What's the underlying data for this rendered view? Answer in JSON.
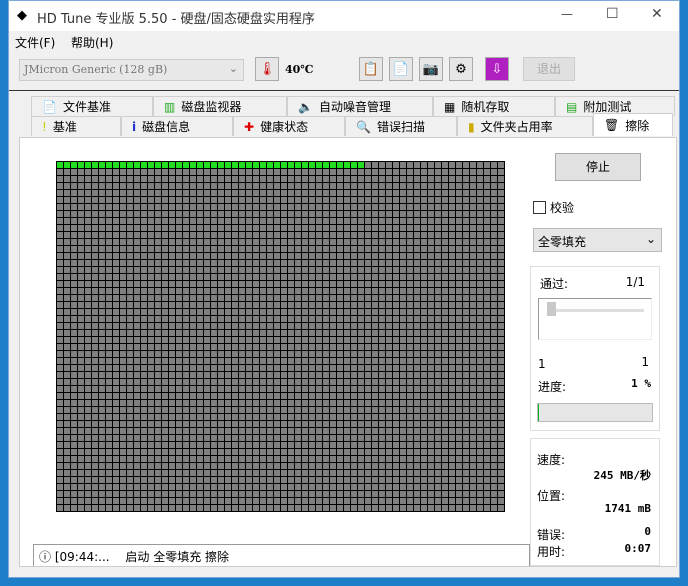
{
  "window": {
    "title": "HD Tune 专业版 5.50 - 硬盘/固态硬盘实用程序",
    "minimize": "—",
    "maximize": "☐",
    "close": "✕"
  },
  "menu": [
    {
      "label": "文件(F)"
    },
    {
      "label": "帮助(H)"
    }
  ],
  "toolbar": {
    "drive": "JMicron Generic (128 gB)",
    "temperature": "40℃",
    "exit": "退出"
  },
  "tabs_row1": [
    {
      "label": "文件基准",
      "icon": "file-benchmark-icon"
    },
    {
      "label": "磁盘监视器",
      "icon": "disk-monitor-icon"
    },
    {
      "label": "自动噪音管理",
      "icon": "speaker-icon"
    },
    {
      "label": "随机存取",
      "icon": "random-access-icon"
    },
    {
      "label": "附加测试",
      "icon": "extra-tests-icon"
    }
  ],
  "tabs_row2": [
    {
      "label": "基准",
      "icon": "benchmark-icon"
    },
    {
      "label": "磁盘信息",
      "icon": "info-icon"
    },
    {
      "label": "健康状态",
      "icon": "health-icon"
    },
    {
      "label": "错误扫描",
      "icon": "magnifier-icon"
    },
    {
      "label": "文件夹占用率",
      "icon": "folder-icon"
    },
    {
      "label": "擦除",
      "icon": "trash-icon"
    }
  ],
  "side": {
    "stop": "停止",
    "verify": "校验",
    "verify_checked": false,
    "method": "全零填充",
    "pass_label": "通过:",
    "pass_value": "1/1",
    "slider_min": "1",
    "slider_max": "1",
    "progress_label": "进度:",
    "progress_value": "1 %",
    "progress": 1,
    "speed_label": "速度:",
    "speed_value": "245 MB/秒",
    "position_label": "位置:",
    "position_value": "1741 mB",
    "errors_label": "错误:",
    "errors_value": "0",
    "time_label": "用时:",
    "time_value": "0:07"
  },
  "grid": {
    "completed_color": "#22dd22",
    "pending_color": "#808080"
  },
  "log": {
    "time": "[09:44:...",
    "message": "启动 全零填充 擦除"
  }
}
